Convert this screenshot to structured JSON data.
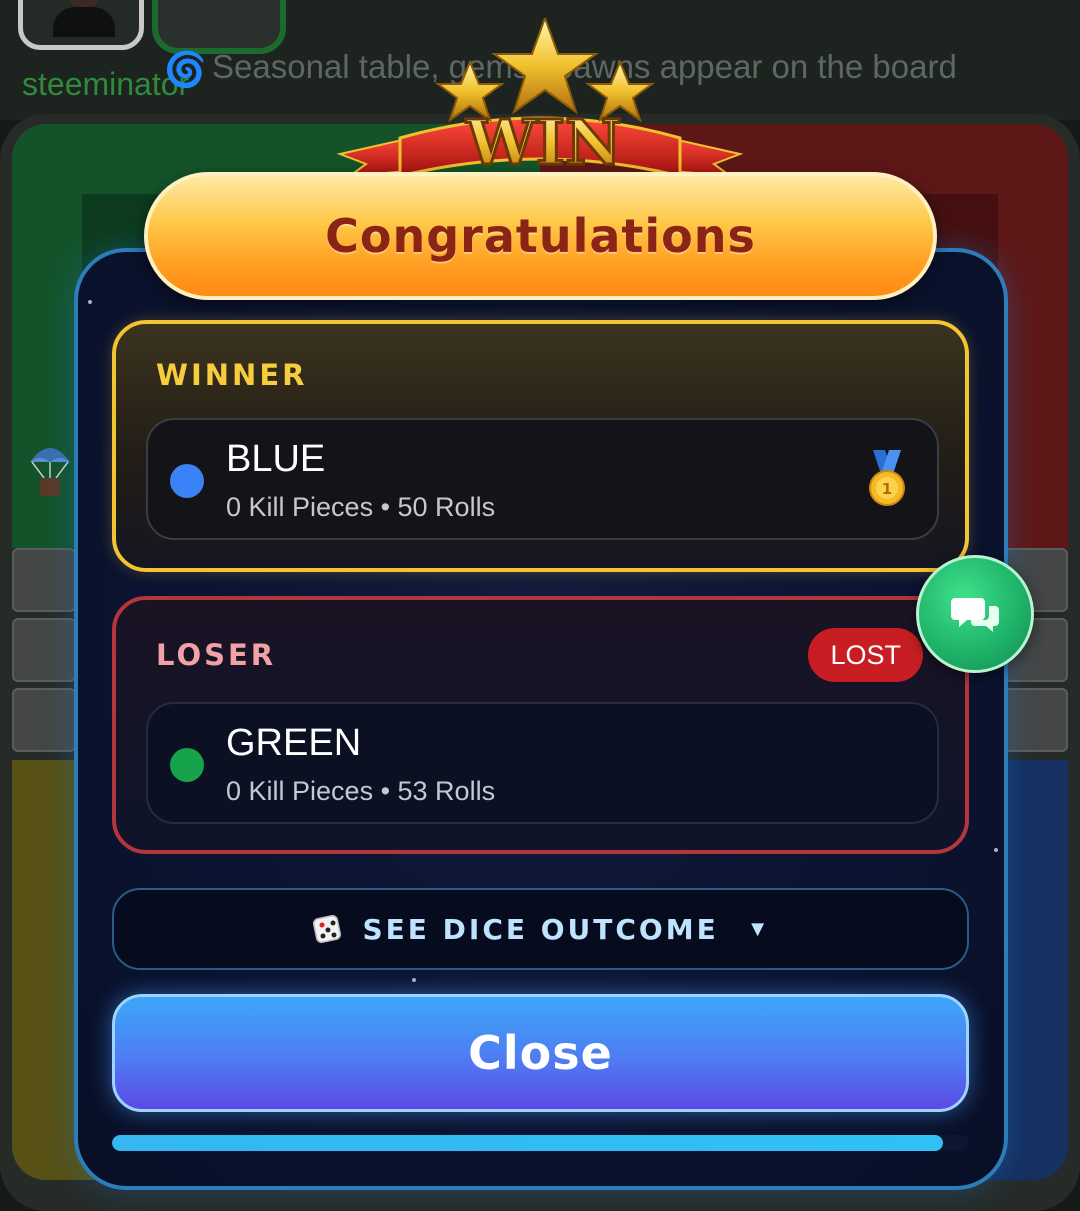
{
  "background": {
    "username": "steeminator",
    "ticker": "Seasonal table, gems spawns appear on the board"
  },
  "modal": {
    "emblem_text": "WIN",
    "title": "Congratulations",
    "winner": {
      "heading": "WINNER",
      "name": "BLUE",
      "color": "#3b82f6",
      "stats": "0 Kill Pieces • 50 Rolls",
      "medal_icon": "gold-medal-icon"
    },
    "loser": {
      "heading": "LOSER",
      "badge": "LOST",
      "name": "GREEN",
      "color": "#16a34a",
      "stats": "0 Kill Pieces • 53 Rolls"
    },
    "dice_toggle": {
      "label": "SEE DICE OUTCOME",
      "icon": "dice-icon",
      "chevron": "▼"
    },
    "close_label": "Close",
    "progress": 0.97
  },
  "colors": {
    "accent_gold": "#f3c431",
    "loser_red": "#b4363c",
    "close_blue": "#3ba7f8",
    "chat_green": "#1fb46a"
  }
}
